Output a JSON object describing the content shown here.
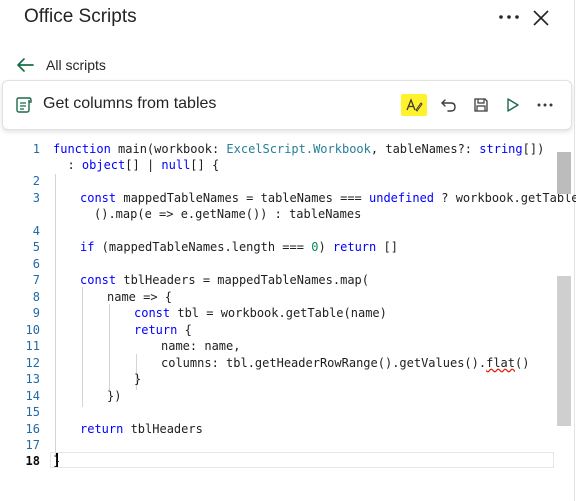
{
  "header": {
    "title": "Office Scripts",
    "more_icon": "more-horizontal-icon",
    "close_icon": "close-icon"
  },
  "nav": {
    "back_label": "All scripts"
  },
  "toolbar": {
    "script_name": "Get columns from tables",
    "buttons": [
      "format-code-icon",
      "undo-icon",
      "save-icon",
      "run-icon",
      "more-horizontal-icon"
    ],
    "highlight_color": "#fff22b"
  },
  "editor": {
    "line_numbers": [
      "1",
      "2",
      "3",
      "4",
      "5",
      "6",
      "7",
      "8",
      "9",
      "10",
      "11",
      "12",
      "13",
      "14",
      "15",
      "16",
      "17",
      "18"
    ],
    "active_line": "18",
    "colors": {
      "keyword": "#0000ff",
      "type": "#267f99",
      "number": "#098658",
      "line_number": "#1f6aa8"
    },
    "code": {
      "l1a_kw": "function",
      "l1a_rest": " main(workbook: ",
      "l1a_type": "ExcelScript.Workbook",
      "l1a_rest2": ", tableNames?: ",
      "l1a_type2": "string",
      "l1a_end": "[])",
      "l1b_pre": "  : ",
      "l1b_type": "object",
      "l1b_mid": "[] | ",
      "l1b_kw": "null",
      "l1b_end": "[] {",
      "l3a_kw": "const",
      "l3a_mid": " mappedTableNames = tableNames === ",
      "l3a_kw2": "undefined",
      "l3a_end": " ? workbook.getTables",
      "l3b": "().map(e => e.getName()) : tableNames",
      "l5_kw": "if",
      "l5_mid": " (mappedTableNames.length === ",
      "l5_num": "0",
      "l5_mid2": ") ",
      "l5_kw2": "return",
      "l5_end": " []",
      "l7_kw": "const",
      "l7_rest": " tblHeaders = mappedTableNames.map(",
      "l8": "name => {",
      "l9_kw": "const",
      "l9_rest": " tbl = workbook.getTable(name)",
      "l10_kw": "return",
      "l10_rest": " {",
      "l11": "name: name,",
      "l12_pre": "columns: tbl.getHeaderRowRange().getValues().",
      "l12_sq": "flat",
      "l12_end": "()",
      "l13": "}",
      "l14": "})",
      "l16_kw": "return",
      "l16_rest": " tblHeaders",
      "l18": "}"
    }
  }
}
